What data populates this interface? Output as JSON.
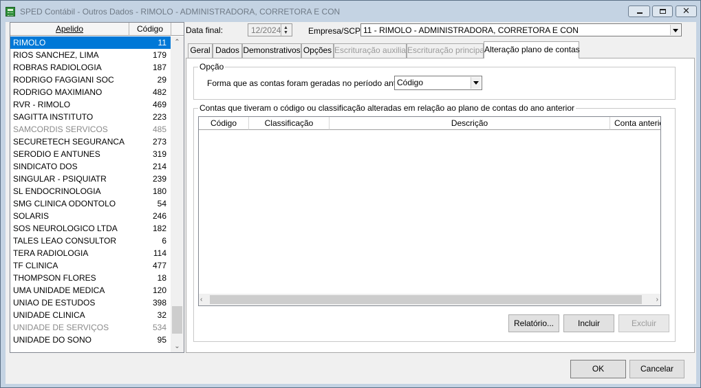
{
  "window": {
    "title": "SPED Contábil - Outros Dados - RIMOLO - ADMINISTRADORA, CORRETORA E CON"
  },
  "list": {
    "col_apelido": "Apelido",
    "col_codigo": "Código",
    "rows": [
      {
        "apelido": "RIMOLO",
        "codigo": "11",
        "state": "selected"
      },
      {
        "apelido": "RIOS SANCHEZ, LIMA",
        "codigo": "179"
      },
      {
        "apelido": "ROBRAS RADIOLOGIA",
        "codigo": "187"
      },
      {
        "apelido": "RODRIGO FAGGIANI SOC",
        "codigo": "29"
      },
      {
        "apelido": "RODRIGO MAXIMIANO",
        "codigo": "482"
      },
      {
        "apelido": "RVR - RIMOLO",
        "codigo": "469"
      },
      {
        "apelido": "SAGITTA INSTITUTO",
        "codigo": "223"
      },
      {
        "apelido": "SAMCORDIS SERVICOS",
        "codigo": "485",
        "state": "gray"
      },
      {
        "apelido": "SECURETECH SEGURANCA",
        "codigo": "273"
      },
      {
        "apelido": "SERODIO E ANTUNES",
        "codigo": "319"
      },
      {
        "apelido": "SINDICATO DOS",
        "codigo": "214"
      },
      {
        "apelido": "SINGULAR - PSIQUIATR",
        "codigo": "239"
      },
      {
        "apelido": "SL ENDOCRINOLOGIA",
        "codigo": "180"
      },
      {
        "apelido": "SMG CLINICA ODONTOLO",
        "codigo": "54"
      },
      {
        "apelido": "SOLARIS",
        "codigo": "246"
      },
      {
        "apelido": "SOS NEUROLOGICO LTDA",
        "codigo": "182"
      },
      {
        "apelido": "TALES LEAO CONSULTOR",
        "codigo": "6"
      },
      {
        "apelido": "TERA RADIOLOGIA",
        "codigo": "114"
      },
      {
        "apelido": "TF CLINICA",
        "codigo": "477"
      },
      {
        "apelido": "THOMPSON FLORES",
        "codigo": "18"
      },
      {
        "apelido": "UMA UNIDADE MEDICA",
        "codigo": "120"
      },
      {
        "apelido": "UNIAO DE ESTUDOS",
        "codigo": "398"
      },
      {
        "apelido": "UNIDADE CLINICA",
        "codigo": "32"
      },
      {
        "apelido": "UNIDADE DE SERVIÇOS",
        "codigo": "534",
        "state": "gray"
      },
      {
        "apelido": "UNIDADE DO SONO",
        "codigo": "95"
      }
    ]
  },
  "header": {
    "data_final_label": "Data final:",
    "data_final_value": "12/2024",
    "empresa_label": "Empresa/SCP:",
    "empresa_value": "11 - RIMOLO - ADMINISTRADORA, CORRETORA E CON"
  },
  "tabs": [
    {
      "label": "Geral"
    },
    {
      "label": "Dados"
    },
    {
      "label": "Demonstrativos"
    },
    {
      "label": "Opções"
    },
    {
      "label": "Escrituração auxiliar",
      "disabled": true
    },
    {
      "label": "Escrituração principal",
      "disabled": true
    },
    {
      "label": "Alteração plano de contas",
      "active": true
    }
  ],
  "opcao": {
    "group_title": "Opção",
    "forma_label": "Forma que as contas foram geradas no período anterior:",
    "forma_value": "Código"
  },
  "contas": {
    "group_title": "Contas que tiveram o código ou classificação alteradas em relação ao plano de contas do ano anterior",
    "columns": [
      "Código",
      "Classificação",
      "Descrição",
      "Conta anterior"
    ]
  },
  "buttons": {
    "relatorio": "Relatório...",
    "incluir": "Incluir",
    "excluir": "Excluir",
    "ok": "OK",
    "cancelar": "Cancelar"
  }
}
